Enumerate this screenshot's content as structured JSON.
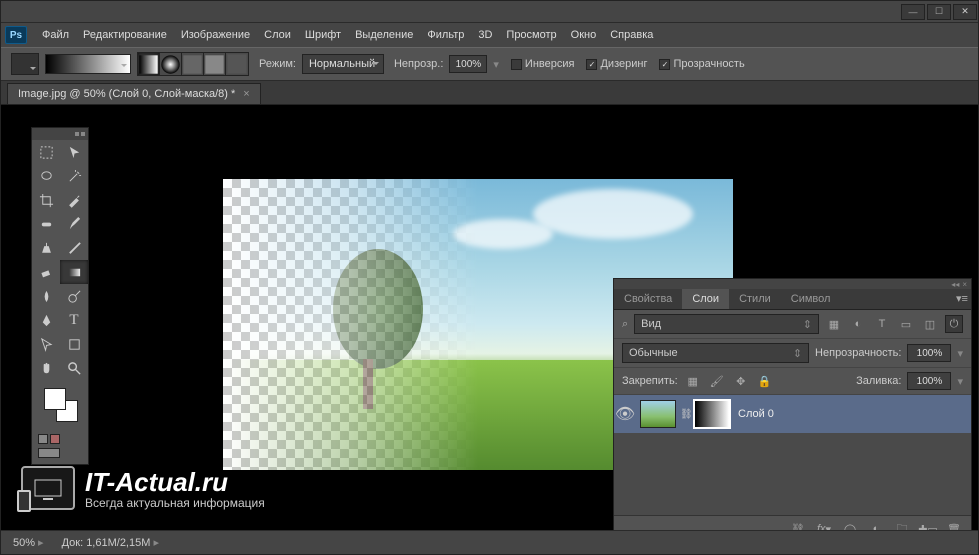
{
  "app_logo": "Ps",
  "menu": [
    "Файл",
    "Редактирование",
    "Изображение",
    "Слои",
    "Шрифт",
    "Выделение",
    "Фильтр",
    "3D",
    "Просмотр",
    "Окно",
    "Справка"
  ],
  "options_bar": {
    "mode_label": "Режим:",
    "mode_value": "Нормальный",
    "opacity_label": "Непрозр.:",
    "opacity_value": "100%",
    "reverse_label": "Инверсия",
    "reverse_checked": false,
    "dither_label": "Дизеринг",
    "dither_checked": true,
    "trans_label": "Прозрачность",
    "trans_checked": true
  },
  "doc_tab": "Image.jpg @ 50% (Слой 0, Слой-маска/8) *",
  "panel": {
    "tabs": [
      "Свойства",
      "Слои",
      "Стили",
      "Символ"
    ],
    "active_tab": 1,
    "search_label": "Вид",
    "blend_value": "Обычные",
    "opacity_label": "Непрозрачность:",
    "opacity_value": "100%",
    "lock_label": "Закрепить:",
    "fill_label": "Заливка:",
    "fill_value": "100%",
    "layer_name": "Слой 0"
  },
  "status": {
    "zoom": "50%",
    "doc_label": "Док:",
    "doc_value": "1,61M/2,15M"
  },
  "watermark": {
    "title": "IT-Actual.ru",
    "sub": "Всегда актуальная информация"
  }
}
